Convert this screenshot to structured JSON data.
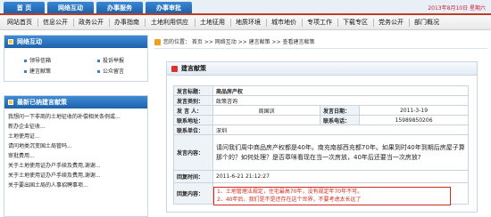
{
  "top_tabs": [
    "首 页",
    "网络互动",
    "办事服务",
    "办事审批"
  ],
  "date": "2013年8月10日 星期六",
  "main_nav": [
    "网站首页",
    "信息公开",
    "政务公开",
    "办事指南",
    "土地利用供应",
    "土地征用",
    "地质环境",
    "城市地价",
    "专项工作",
    "下载专区",
    "党务公开",
    "部门概况"
  ],
  "left_panel": {
    "title": "网络互动",
    "links": [
      "领导信箱",
      "投诉举报",
      "建言献策",
      "公众留言"
    ]
  },
  "latest_panel": {
    "title": "最新已纳建言献策",
    "items": [
      "我想问一下非商的土地征收的补偿相关条例或...",
      "新办企业征收...",
      "土地使用证...",
      "请问地类沉变国土局管吗...",
      "审批费用...",
      "关于土地使用证办户手续及费用,谢谢...",
      "关于土地使用证办户手续及费用,谢谢...",
      "关于要出国土局的人事招聘事项..."
    ]
  },
  "breadcrumb": "您的位置： 首页 >> 网络互动 >> 建言献策 >> 查看建言献策",
  "section_title": "建言献策",
  "form": {
    "title_label": "发言标题：",
    "title_value": "商品房产权",
    "category_label": "发言类别：",
    "category_value": "政策咨询",
    "speaker_label": "发 言 人：",
    "speaker_value": "周国训",
    "date_label": "发言日期：",
    "date_value": "2011-3-19",
    "address_label": "联系地址：",
    "address_value": "",
    "phone_label": "联系电话：",
    "phone_value": "15989850206",
    "dept_label": "联系单位：",
    "dept_value": "深圳",
    "content_label": "发言内容：",
    "content_value": "请问我们周中商品房产权都是40年。南充南部西充都70年。如果到时40年到期后房屋子算那个的？如何处理？是否章咪看现在当一次房放，40年后还要当一次房放?",
    "reply_time_label": "回复时间：",
    "reply_time_value": "2011-6-21 21:12:27",
    "reply_label": "回复内容：",
    "reply_lines": [
      "1、土地管理法规定，住宅最高70年，没有规定年70年不可。",
      "2、40年后，我们是不是还存在这个世界，不要考虑太长远了"
    ]
  }
}
